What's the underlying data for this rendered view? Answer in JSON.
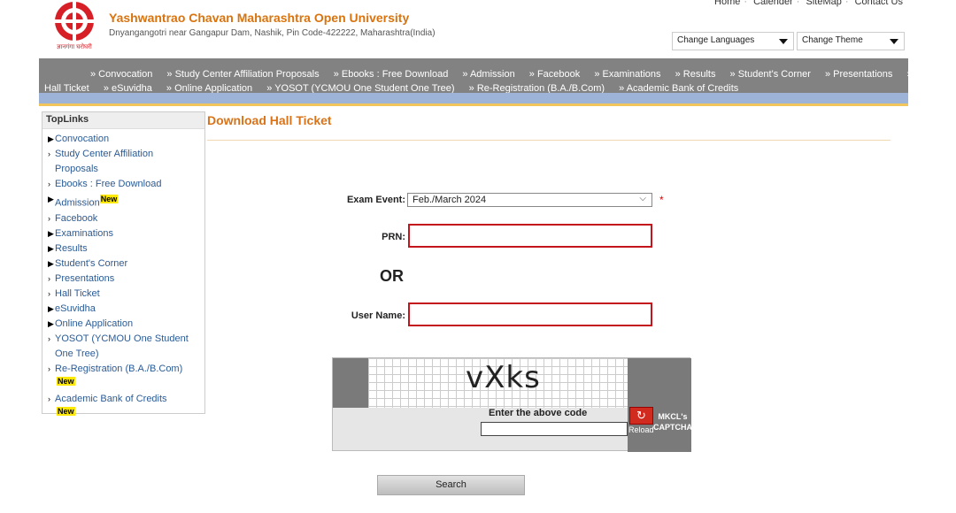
{
  "header": {
    "university_name": "Yashwantrao Chavan Maharashtra Open University",
    "address": "Dnyangangotri near Gangapur Dam, Nashik, Pin Code-422222, Maharashtra(India)",
    "logo_text": "ज्ञानगंगा घरोघरी",
    "top_links": [
      "Home",
      "Calender",
      "SiteMap",
      "Contact Us"
    ],
    "language_select": "Change Languages",
    "theme_select": "Change Theme"
  },
  "nav": {
    "line1": [
      "» Convocation",
      "» Study Center Affiliation Proposals",
      "» Ebooks : Free Download",
      "» Admission",
      "» Facebook",
      "» Examinations",
      "» Results",
      "» Student's Corner",
      "» Presentations",
      "»"
    ],
    "line2": [
      "Hall Ticket",
      "» eSuvidha",
      "» Online Application",
      "» YOSOT (YCMOU One Student One Tree)",
      "» Re-Registration (B.A./B.Com)",
      "» Academic Bank of Credits"
    ]
  },
  "sidebar": {
    "heading": "TopLinks",
    "items": [
      {
        "label": "Convocation",
        "arrow": "▶"
      },
      {
        "label": "Study Center Affiliation",
        "arrow": "›"
      },
      {
        "label": "Proposals",
        "arrow": ""
      },
      {
        "label": "Ebooks : Free Download",
        "arrow": "›"
      },
      {
        "label": "Admission",
        "arrow": "▶"
      },
      {
        "label": "Facebook",
        "arrow": "›"
      },
      {
        "label": "Examinations",
        "arrow": "▶"
      },
      {
        "label": "Results",
        "arrow": "▶"
      },
      {
        "label": "Student's Corner",
        "arrow": "▶"
      },
      {
        "label": "Presentations",
        "arrow": "›"
      },
      {
        "label": "Hall Ticket",
        "arrow": "›"
      },
      {
        "label": "eSuvidha",
        "arrow": "▶"
      },
      {
        "label": "Online Application",
        "arrow": "▶"
      },
      {
        "label": "YOSOT (YCMOU One Student",
        "arrow": "›"
      },
      {
        "label": "One Tree)",
        "arrow": ""
      },
      {
        "label": "Re-Registration (B.A./B.Com)",
        "arrow": "›"
      },
      {
        "label": "Academic Bank of Credits",
        "arrow": "›"
      }
    ],
    "new_badge": "New"
  },
  "main": {
    "title": "Download Hall Ticket",
    "exam_event_label": "Exam Event:",
    "exam_event_value": "Feb./March 2024",
    "required_mark": "*",
    "prn_label": "PRN:",
    "or_text": "OR",
    "username_label": "User Name:",
    "captcha_text": "vXks",
    "captcha_prompt": "Enter the above code",
    "reload_label": "Reload",
    "captcha_brand": "MKCL's CAPTCHA",
    "search_label": "Search"
  }
}
